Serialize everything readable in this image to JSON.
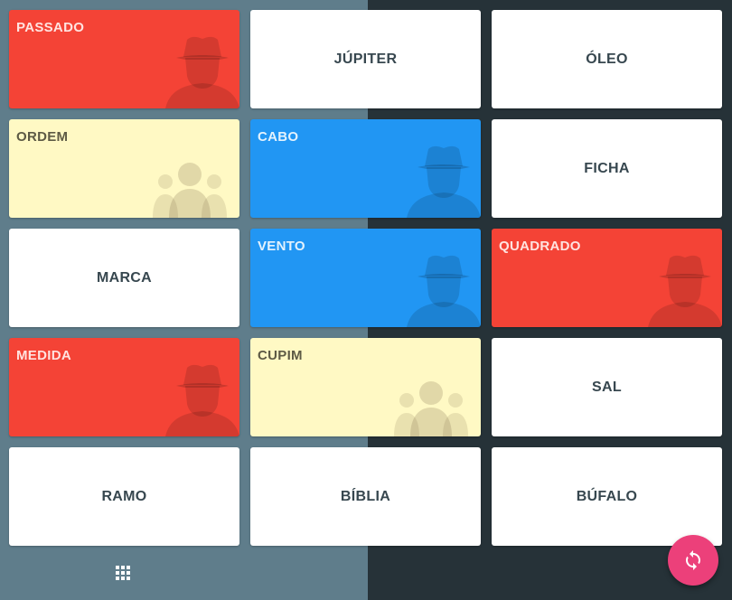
{
  "board": {
    "cards": [
      {
        "word": "PASSADO",
        "team": "red",
        "revealed": true
      },
      {
        "word": "JÚPITER",
        "team": "hidden",
        "revealed": false
      },
      {
        "word": "ÓLEO",
        "team": "hidden",
        "revealed": false
      },
      {
        "word": "ORDEM",
        "team": "neutral",
        "revealed": true
      },
      {
        "word": "CABO",
        "team": "blue",
        "revealed": true
      },
      {
        "word": "FICHA",
        "team": "hidden",
        "revealed": false
      },
      {
        "word": "MARCA",
        "team": "hidden",
        "revealed": false
      },
      {
        "word": "VENTO",
        "team": "blue",
        "revealed": true
      },
      {
        "word": "QUADRADO",
        "team": "red",
        "revealed": true
      },
      {
        "word": "MEDIDA",
        "team": "red",
        "revealed": true
      },
      {
        "word": "CUPIM",
        "team": "neutral",
        "revealed": true
      },
      {
        "word": "SAL",
        "team": "hidden",
        "revealed": false
      },
      {
        "word": "RAMO",
        "team": "hidden",
        "revealed": false
      },
      {
        "word": "BÍBLIA",
        "team": "hidden",
        "revealed": false
      },
      {
        "word": "BÚFALO",
        "team": "hidden",
        "revealed": false
      }
    ]
  },
  "controls": {
    "grid_icon": "grid-view-icon",
    "refresh_icon": "refresh-icon"
  },
  "colors": {
    "red_team": "#f44336",
    "blue_team": "#2196f3",
    "neutral": "#fff9c4",
    "fab": "#ec407a",
    "left_panel": "#5f7d8b",
    "right_panel": "#263238"
  }
}
